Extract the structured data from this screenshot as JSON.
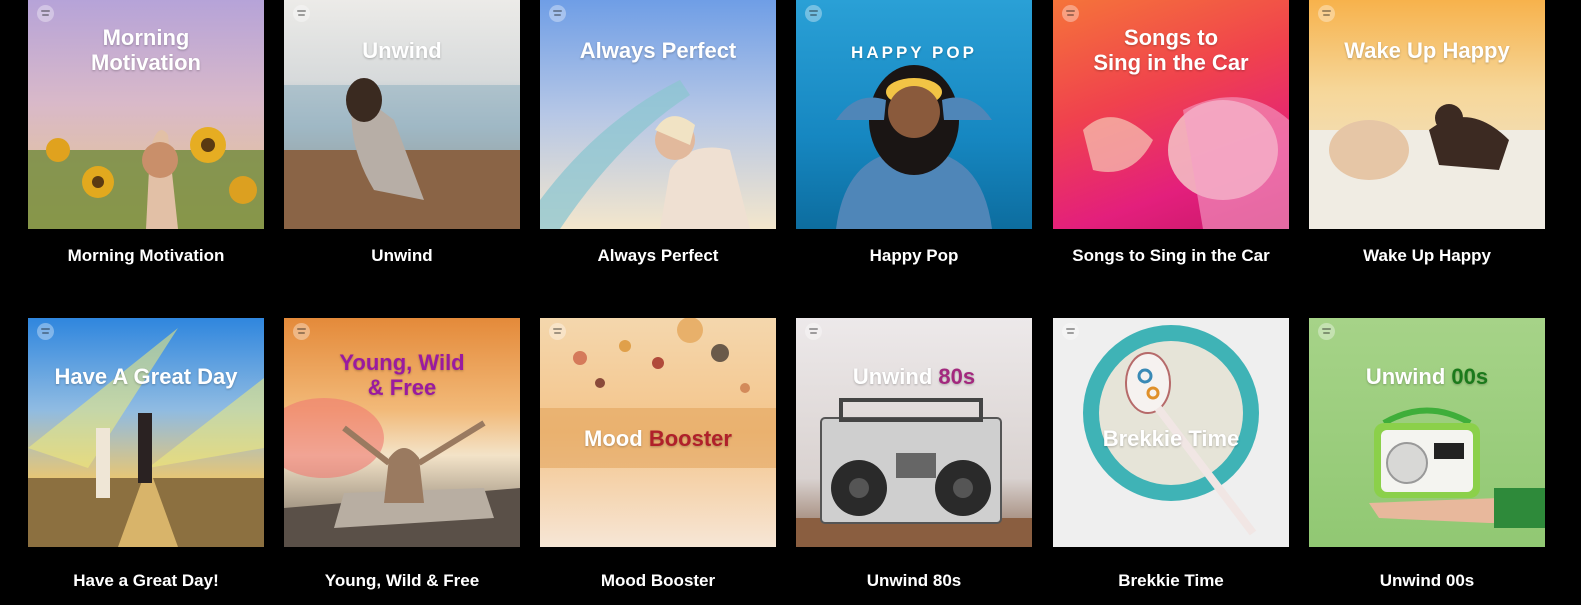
{
  "playlists": [
    {
      "cover_title_line1": "Morning",
      "cover_title_line2": "Motivation",
      "caption": "Morning Motivation",
      "bg": [
        "#b9a7d6",
        "#e6c88a"
      ]
    },
    {
      "cover_title_line1": "Unwind",
      "cover_title_line2": "",
      "caption": "Unwind",
      "bg": [
        "#e3e1dd",
        "#a9a294"
      ]
    },
    {
      "cover_title_line1": "Always Perfect",
      "cover_title_line2": "",
      "caption": "Always Perfect",
      "bg": [
        "#7aa4e6",
        "#efe3c8"
      ]
    },
    {
      "cover_title_line1": "HAPPY POP",
      "cover_title_line2": "",
      "caption": "Happy Pop",
      "bg": [
        "#1f8fc9",
        "#0c6fa3"
      ]
    },
    {
      "cover_title_line1": "Songs to",
      "cover_title_line2": "Sing in the Car",
      "caption": "Songs to Sing in the Car",
      "bg": [
        "#f26a3a",
        "#e7207a"
      ]
    },
    {
      "cover_title_line1": "Wake Up Happy",
      "cover_title_line2": "",
      "caption": "Wake Up Happy",
      "bg": [
        "#f6b756",
        "#f0e6d6"
      ]
    },
    {
      "cover_title_line1": "Have A Great Day",
      "cover_title_line2": "",
      "caption": "Have a Great Day!",
      "bg": [
        "#3a8fe0",
        "#c9a24a"
      ]
    },
    {
      "cover_title_line1": "Young, Wild",
      "cover_title_line2": "& Free",
      "caption": "Young, Wild & Free",
      "bg": [
        "#e79a45",
        "#8a6a4a"
      ]
    },
    {
      "cover_title_line1": "Mood",
      "cover_title_line2": "Booster",
      "caption": "Mood Booster",
      "bg": [
        "#f4d8ae",
        "#f6e8d6"
      ]
    },
    {
      "cover_title_line1": "Unwind",
      "cover_title_line2": "80s",
      "caption": "Unwind 80s",
      "bg": [
        "#e8e3e3",
        "#9b8677"
      ]
    },
    {
      "cover_title_line1": "Brekkie Time",
      "cover_title_line2": "",
      "caption": "Brekkie Time",
      "bg": [
        "#f1f1f1",
        "#e2e2e2"
      ]
    },
    {
      "cover_title_line1": "Unwind",
      "cover_title_line2": "00s",
      "caption": "Unwind 00s",
      "bg": [
        "#a9d48a",
        "#86c06a"
      ]
    }
  ]
}
